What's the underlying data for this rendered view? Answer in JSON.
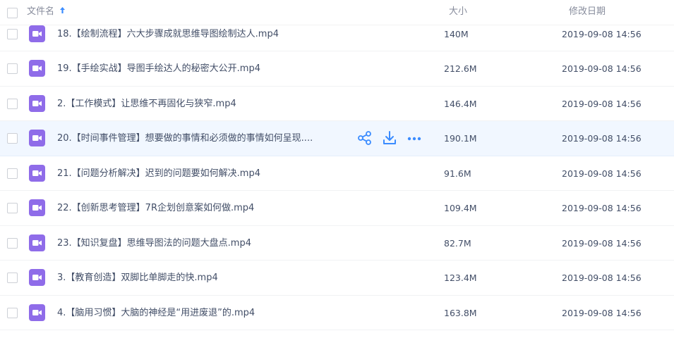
{
  "header": {
    "name_label": "文件名",
    "size_label": "大小",
    "date_label": "修改日期",
    "sort_icon": "arrow-up-icon"
  },
  "colors": {
    "accent": "#3b8cff",
    "video_icon_bg": "#8f6ce9",
    "hover_row": "#f1f7ff"
  },
  "files": [
    {
      "name": "18.【绘制流程】六大步骤成就思维导图绘制达人.mp4",
      "size": "140M",
      "date": "2019-09-08 14:56"
    },
    {
      "name": "19.【手绘实战】导图手绘达人的秘密大公开.mp4",
      "size": "212.6M",
      "date": "2019-09-08 14:56"
    },
    {
      "name": "2.【工作模式】让思维不再固化与狭窄.mp4",
      "size": "146.4M",
      "date": "2019-09-08 14:56"
    },
    {
      "name": "20.【时间事件管理】想要做的事情和必须做的事情如何呈现....",
      "size": "190.1M",
      "date": "2019-09-08 14:56"
    },
    {
      "name": "21.【问题分析解决】迟到的问题要如何解决.mp4",
      "size": "91.6M",
      "date": "2019-09-08 14:56"
    },
    {
      "name": "22.【创新思考管理】7R企划创意案如何做.mp4",
      "size": "109.4M",
      "date": "2019-09-08 14:56"
    },
    {
      "name": "23.【知识复盘】思维导图法的问题大盘点.mp4",
      "size": "82.7M",
      "date": "2019-09-08 14:56"
    },
    {
      "name": "3.【教育创造】双脚比单脚走的快.mp4",
      "size": "123.4M",
      "date": "2019-09-08 14:56"
    },
    {
      "name": "4.【脑用习惯】大脑的神经是“用进废退”的.mp4",
      "size": "163.8M",
      "date": "2019-09-08 14:56"
    }
  ],
  "row_actions": [
    "share-icon",
    "download-icon",
    "more-icon"
  ]
}
